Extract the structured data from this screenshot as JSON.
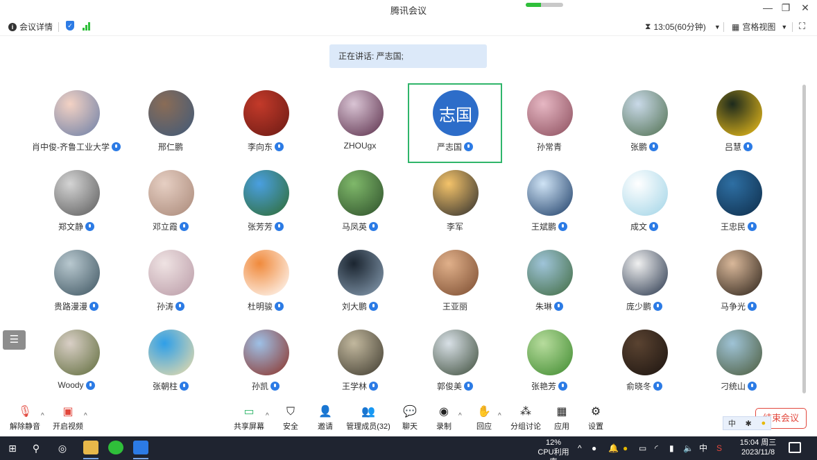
{
  "window": {
    "title": "腾讯会议",
    "network_level": 0.4,
    "minimize": "—",
    "restore": "❐",
    "close": "✕"
  },
  "infobar": {
    "meeting_details": "会议详情",
    "timer": "13:05(60分钟)",
    "view_mode": "宫格视图"
  },
  "speaking": {
    "text": "正在讲话: 严志国;"
  },
  "participants": [
    {
      "name": "肖中俊-齐鲁工业大学",
      "mic": true,
      "colors": [
        "#f3d2c4",
        "#6b7ea6"
      ]
    },
    {
      "name": "邢仁鹏",
      "mic": false,
      "colors": [
        "#8a6c56",
        "#3f5a7a"
      ]
    },
    {
      "name": "李向东",
      "mic": true,
      "colors": [
        "#c33a2a",
        "#6a1a14"
      ]
    },
    {
      "name": "ZHOUgx",
      "mic": false,
      "colors": [
        "#d9c4d4",
        "#5a2e4a"
      ]
    },
    {
      "name": "严志国",
      "mic": true,
      "avatar_text": "志国",
      "active": true,
      "colors": [
        "#2d6dc9",
        "#2d6dc9"
      ]
    },
    {
      "name": "孙常青",
      "mic": false,
      "colors": [
        "#e6b7c3",
        "#8b4d5c"
      ]
    },
    {
      "name": "张鹏",
      "mic": true,
      "colors": [
        "#c9d9e8",
        "#4f6f4f"
      ]
    },
    {
      "name": "吕慧",
      "mic": true,
      "colors": [
        "#1d2a1c",
        "#f2c21b"
      ]
    },
    {
      "name": "郑文静",
      "mic": true,
      "colors": [
        "#d4d4d4",
        "#5a5a5a"
      ]
    },
    {
      "name": "邓立霞",
      "mic": true,
      "colors": [
        "#e6cfc3",
        "#a98878"
      ]
    },
    {
      "name": "张芳芳",
      "mic": true,
      "colors": [
        "#4a9fe0",
        "#2f6b2f"
      ]
    },
    {
      "name": "马凤英",
      "mic": true,
      "colors": [
        "#7fb86a",
        "#2d4f2a"
      ]
    },
    {
      "name": "李军",
      "mic": false,
      "colors": [
        "#f4c36a",
        "#2c2c2c"
      ]
    },
    {
      "name": "王斌鹏",
      "mic": true,
      "colors": [
        "#cfe3f5",
        "#1b3c66"
      ]
    },
    {
      "name": "成文",
      "mic": true,
      "colors": [
        "#ffffff",
        "#9fd3e6"
      ]
    },
    {
      "name": "王忠民",
      "mic": true,
      "colors": [
        "#2e6fa3",
        "#0e2d4a"
      ]
    },
    {
      "name": "贵路漫漫",
      "mic": true,
      "colors": [
        "#b8c8cf",
        "#3d5460"
      ]
    },
    {
      "name": "孙涛",
      "mic": true,
      "colors": [
        "#efe3e3",
        "#b99aa6"
      ]
    },
    {
      "name": "杜明骏",
      "mic": true,
      "colors": [
        "#f08a3c",
        "#ffffff"
      ]
    },
    {
      "name": "刘大鹏",
      "mic": true,
      "colors": [
        "#1b2530",
        "#8aa0b5"
      ]
    },
    {
      "name": "王亚丽",
      "mic": false,
      "colors": [
        "#e0b08a",
        "#7a4b2f"
      ]
    },
    {
      "name": "朱琳",
      "mic": true,
      "colors": [
        "#9fc4d9",
        "#3f6a3f"
      ]
    },
    {
      "name": "庞少鹏",
      "mic": true,
      "colors": [
        "#f0f0f0",
        "#26344a"
      ]
    },
    {
      "name": "马争光",
      "mic": true,
      "colors": [
        "#d9b89a",
        "#2b2118"
      ]
    },
    {
      "name": "Woody",
      "mic": true,
      "colors": [
        "#d9cfc6",
        "#5e6b3a"
      ]
    },
    {
      "name": "张朝柱",
      "mic": true,
      "colors": [
        "#2f9fe8",
        "#f1dea7"
      ]
    },
    {
      "name": "孙凯",
      "mic": true,
      "colors": [
        "#9ec0e6",
        "#8c3025"
      ]
    },
    {
      "name": "王学林",
      "mic": true,
      "colors": [
        "#c2b89e",
        "#3e3a2e"
      ]
    },
    {
      "name": "郭俊美",
      "mic": true,
      "colors": [
        "#d8e0e6",
        "#3c4c3a"
      ]
    },
    {
      "name": "张艳芳",
      "mic": true,
      "colors": [
        "#b7dc9d",
        "#3e8a2e"
      ]
    },
    {
      "name": "俞晓冬",
      "mic": true,
      "colors": [
        "#5a4331",
        "#1c1410"
      ]
    },
    {
      "name": "刁统山",
      "mic": true,
      "colors": [
        "#9fc3d6",
        "#4a5a3a"
      ]
    }
  ],
  "toolbar": {
    "unmute": "解除静音",
    "start_video": "开启视频",
    "share_screen": "共享屏幕",
    "security": "安全",
    "invite": "邀请",
    "manage_members": "管理成员(32)",
    "chat": "聊天",
    "record": "录制",
    "react": "回应",
    "breakout": "分组讨论",
    "apps": "应用",
    "settings": "设置",
    "end_meeting": "结束会议"
  },
  "ime": {
    "lang": "中"
  },
  "taskbar": {
    "cpu_percent": "12%",
    "cpu_label": "CPU利用率",
    "ime_lang": "中",
    "time": "15:04 周三",
    "date": "2023/11/8"
  },
  "colors": {
    "accent": "#2c7be5",
    "active_border": "#2fb56a",
    "end": "#e2473c",
    "banner": "#dce9f9"
  }
}
